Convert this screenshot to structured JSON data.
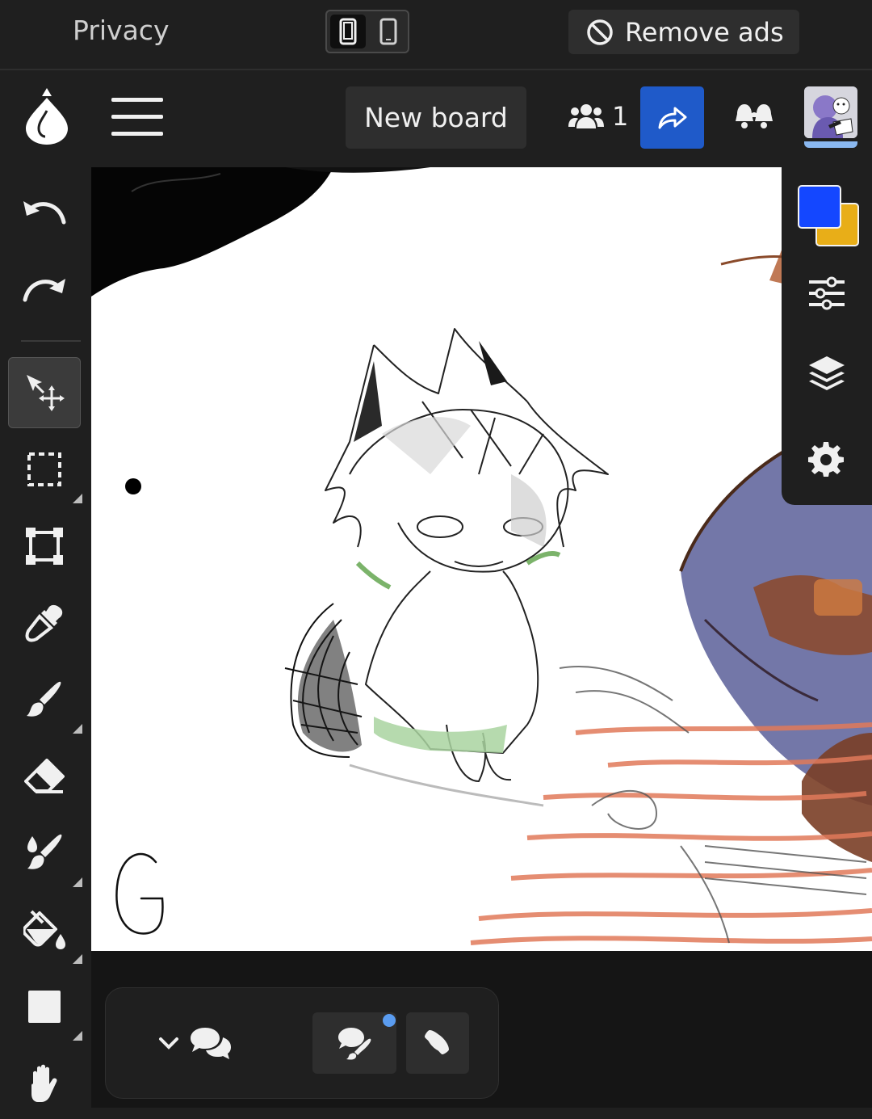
{
  "topbar": {
    "privacy_label": "Privacy",
    "remove_ads_label": "Remove ads"
  },
  "header": {
    "new_board_label": "New board",
    "users_count": "1"
  },
  "toolbar": {
    "tools": [
      "undo-icon",
      "redo-icon",
      "move-select-icon",
      "rect-select-icon",
      "transform-icon",
      "eyedropper-icon",
      "brush-icon",
      "eraser-icon",
      "blend-brush-icon",
      "fill-bucket-icon",
      "shape-icon",
      "hand-icon"
    ],
    "active_tool": "move-select-icon"
  },
  "colors": {
    "primary": "#1447ff",
    "secondary": "#e8ae18",
    "share_button": "#1f5ac9",
    "notification_dot": "#5a9cf0"
  },
  "canvas": {
    "signature": "G"
  }
}
